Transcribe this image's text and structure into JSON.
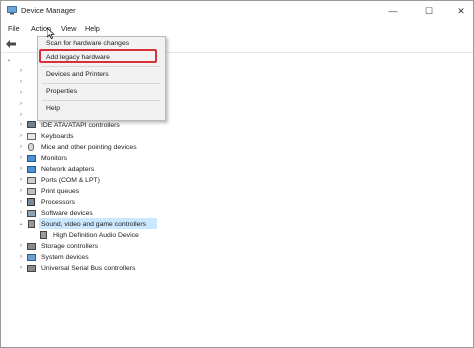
{
  "window": {
    "title": "Device Manager",
    "minimize": "—",
    "maximize": "☐",
    "close": "✕"
  },
  "menu": {
    "file": "File",
    "action": "Action",
    "view": "View",
    "help": "Help"
  },
  "dropdown": {
    "scan": "Scan for hardware changes",
    "add_legacy": "Add legacy hardware",
    "devices_printers": "Devices and Printers",
    "properties": "Properties",
    "help": "Help"
  },
  "tree": {
    "items": [
      {
        "label": "IDE ATA/ATAPI controllers",
        "icon": "ide-controller-icon"
      },
      {
        "label": "Keyboards",
        "icon": "keyboard-icon"
      },
      {
        "label": "Mice and other pointing devices",
        "icon": "mouse-icon"
      },
      {
        "label": "Monitors",
        "icon": "monitor-icon"
      },
      {
        "label": "Network adapters",
        "icon": "network-adapter-icon"
      },
      {
        "label": "Ports (COM & LPT)",
        "icon": "port-icon"
      },
      {
        "label": "Print queues",
        "icon": "printer-icon"
      },
      {
        "label": "Processors",
        "icon": "processor-icon"
      },
      {
        "label": "Software devices",
        "icon": "software-device-icon"
      },
      {
        "label": "Sound, video and game controllers",
        "icon": "sound-icon",
        "expanded": true,
        "selected": true
      },
      {
        "label": "High Definition Audio Device",
        "icon": "speaker-icon",
        "child": true
      },
      {
        "label": "Storage controllers",
        "icon": "storage-icon"
      },
      {
        "label": "System devices",
        "icon": "system-device-icon"
      },
      {
        "label": "Universal Serial Bus controllers",
        "icon": "usb-icon"
      }
    ]
  },
  "colors": {
    "selection": "#cce8ff",
    "highlight_border": "#d6303a",
    "menu_active": "#cce4f7"
  }
}
